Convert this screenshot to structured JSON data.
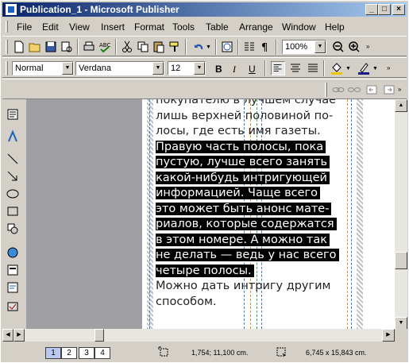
{
  "window": {
    "title": "Publication_1 - Microsoft Publisher",
    "controls": {
      "minimize": "_",
      "maximize": "□",
      "close": "×"
    }
  },
  "menu": [
    {
      "label": "File"
    },
    {
      "label": "Edit"
    },
    {
      "label": "View"
    },
    {
      "label": "Insert"
    },
    {
      "label": "Format"
    },
    {
      "label": "Tools"
    },
    {
      "label": "Table"
    },
    {
      "label": "Arrange"
    },
    {
      "label": "Window"
    },
    {
      "label": "Help"
    }
  ],
  "standard_toolbar": {
    "zoom": "100%"
  },
  "formatting_toolbar": {
    "style": "Normal",
    "font": "Verdana",
    "size": "12",
    "bold": "B",
    "italic": "I",
    "underline": "U"
  },
  "document": {
    "lines": [
      {
        "text": "покупателю в лучшем случае",
        "selected": false
      },
      {
        "text": "лишь верхней половиной по-",
        "selected": false
      },
      {
        "text": "лосы, где есть имя газеты.",
        "selected": false
      },
      {
        "text": "Правую часть полосы, пока",
        "selected": true
      },
      {
        "text": "пустую, лучше всего занять",
        "selected": true
      },
      {
        "text": "какой-нибудь интригующей",
        "selected": true
      },
      {
        "text": "информацией. Чаще всего",
        "selected": true
      },
      {
        "text": "это может быть анонс мате-",
        "selected": true
      },
      {
        "text": "риалов, которые содержатся",
        "selected": true
      },
      {
        "text": "в этом номере. А можно так",
        "selected": true
      },
      {
        "text": "не делать — ведь у нас всего",
        "selected": true
      },
      {
        "text": "четыре полосы.",
        "selected": true
      },
      {
        "text": "Можно дать интригу другим",
        "selected": false
      },
      {
        "text": "способом.",
        "selected": false
      }
    ]
  },
  "status": {
    "pages": [
      "1",
      "2",
      "3",
      "4"
    ],
    "active_page": "1",
    "position": "1,754; 11,100 cm.",
    "size": "6,745 x 15,843 cm."
  },
  "colors": {
    "title_gradient_start": "#0a246a",
    "title_gradient_end": "#a6caf0",
    "selection": "#000000",
    "guide_blue": "#3a7bd5",
    "guide_orange": "#e08a2a",
    "guide_green": "#3aa84a"
  }
}
